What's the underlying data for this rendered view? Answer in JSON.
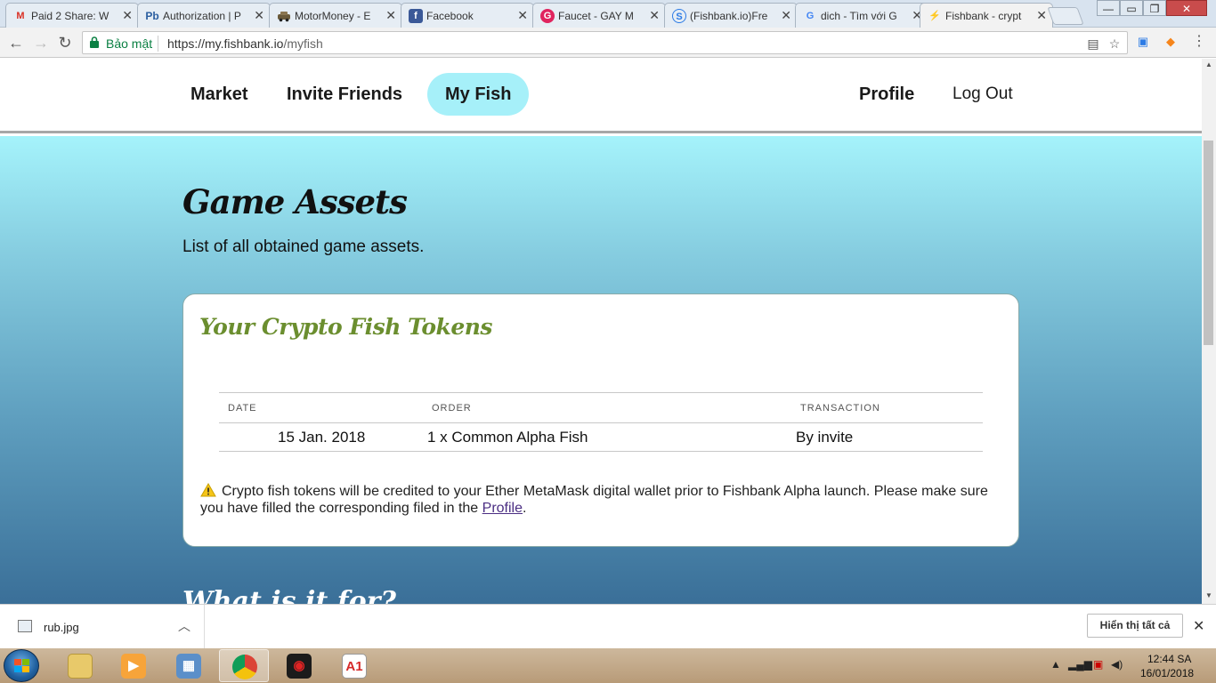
{
  "browser": {
    "tabs": [
      {
        "title": "Paid 2 Share: W",
        "icon": "gmail-icon",
        "icon_text": "M",
        "icon_color": "#d93025"
      },
      {
        "title": "Authorization | P",
        "icon": "pb-icon",
        "icon_text": "Pb",
        "icon_color": "#2a5d9f"
      },
      {
        "title": "MotorMoney - E",
        "icon": "car-icon",
        "icon_text": "",
        "icon_color": "#444"
      },
      {
        "title": "Facebook",
        "icon": "facebook-icon",
        "icon_text": "f",
        "icon_color": "#3b5998"
      },
      {
        "title": "Faucet - GAY M",
        "icon": "faucet-icon",
        "icon_text": "G",
        "icon_color": "#e0245e"
      },
      {
        "title": "(Fishbank.io)Fre",
        "icon": "fishbank-s-icon",
        "icon_text": "S",
        "icon_color": "#2c7be5"
      },
      {
        "title": "dich - Tìm với G",
        "icon": "google-icon",
        "icon_text": "G",
        "icon_color": "#4285f4"
      },
      {
        "title": "Fishbank - crypt",
        "icon": "lightning-icon",
        "icon_text": "⚡",
        "icon_color": "#f5a623"
      }
    ],
    "active_tab": 7,
    "address": {
      "secure_label": "Bảo mật",
      "url_main": "https://my.fishbank.io",
      "url_path": "/myfish"
    }
  },
  "site_nav": {
    "market": "Market",
    "invite": "Invite Friends",
    "myfish": "My Fish",
    "profile": "Profile",
    "logout": "Log Out"
  },
  "page": {
    "title": "Game Assets",
    "subtitle": "List of all obtained game assets.",
    "next_heading": "What is it for?"
  },
  "card": {
    "title": "Your Crypto Fish Tokens",
    "columns": [
      "DATE",
      "ORDER",
      "TRANSACTION"
    ],
    "rows": [
      {
        "date": "15 Jan. 2018",
        "order": "1 x Common Alpha Fish",
        "transaction": "By invite"
      }
    ],
    "notice_text": "Crypto fish tokens will be credited to your Ether MetaMask digital wallet prior to Fishbank Alpha launch. Please make sure you have filled the corresponding filed in the ",
    "notice_link": "Profile",
    "notice_end": "."
  },
  "downloads": {
    "file": "rub.jpg",
    "show_all": "Hiển thị tất cả"
  },
  "taskbar": {
    "time": "12:44 SA",
    "date": "16/01/2018",
    "apps": [
      "explorer",
      "media-player",
      "control-panel",
      "chrome",
      "garena",
      "a1"
    ]
  },
  "colors": {
    "active_nav": "#a6f0f9",
    "card_title": "#6b8e2f",
    "secure": "#0b8043"
  }
}
